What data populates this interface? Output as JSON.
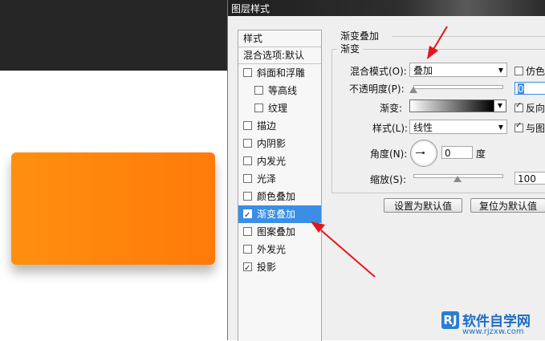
{
  "dialog": {
    "title": "图层样式"
  },
  "style_list": {
    "header": "样式",
    "blend_options": "混合选项:默认",
    "items": [
      {
        "label": "斜面和浮雕",
        "checked": false,
        "sub": false,
        "active": false
      },
      {
        "label": "等高线",
        "checked": false,
        "sub": true,
        "active": false
      },
      {
        "label": "纹理",
        "checked": false,
        "sub": true,
        "active": false
      },
      {
        "label": "描边",
        "checked": false,
        "sub": false,
        "active": false
      },
      {
        "label": "内阴影",
        "checked": false,
        "sub": false,
        "active": false
      },
      {
        "label": "内发光",
        "checked": false,
        "sub": false,
        "active": false
      },
      {
        "label": "光泽",
        "checked": false,
        "sub": false,
        "active": false
      },
      {
        "label": "颜色叠加",
        "checked": false,
        "sub": false,
        "active": false
      },
      {
        "label": "渐变叠加",
        "checked": true,
        "sub": false,
        "active": true
      },
      {
        "label": "图案叠加",
        "checked": false,
        "sub": false,
        "active": false
      },
      {
        "label": "外发光",
        "checked": false,
        "sub": false,
        "active": false
      },
      {
        "label": "投影",
        "checked": true,
        "sub": false,
        "active": false
      }
    ]
  },
  "panel": {
    "group_title": "渐变叠加",
    "section_title": "渐变",
    "blend_mode_label": "混合模式(O):",
    "blend_mode_value": "叠加",
    "dither_label": "仿色",
    "opacity_label": "不透明度(P):",
    "opacity_value": "0",
    "opacity_fraction": 0,
    "gradient_label": "渐变:",
    "reverse_label": "反向",
    "style_label": "样式(L):",
    "style_value": "线性",
    "align_label": "与图",
    "angle_label": "角度(N):",
    "angle_value": "0",
    "angle_unit": "度",
    "scale_label": "缩放(S):",
    "scale_value": "100",
    "scale_fraction": 0.5,
    "btn_default": "设置为默认值",
    "btn_reset": "复位为默认值"
  },
  "canvas": {
    "dark_color": "#262626",
    "rect_color_start": "#ff8f0f",
    "rect_color_end": "#ff7a0a"
  },
  "watermark": {
    "logo": "RJ",
    "title": "软件自学网",
    "url": "www.rjzxw.com"
  },
  "accent_color": "#3a8ee6",
  "arrow_color": "#e8141b"
}
